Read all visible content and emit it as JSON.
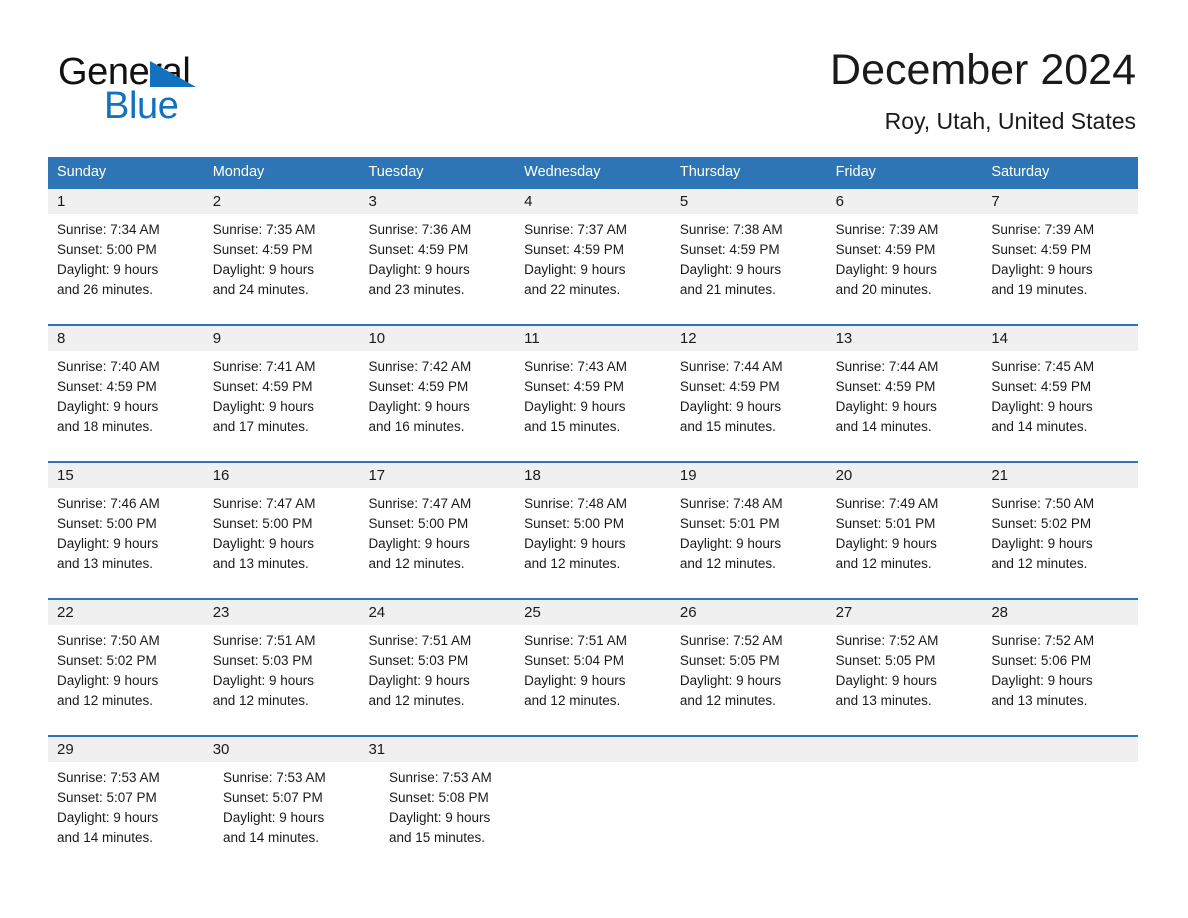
{
  "brand": {
    "name_part1": "General",
    "name_part2": "Blue",
    "triangle_icon": "blue-triangle-icon",
    "accent_color": "#1272bd"
  },
  "header": {
    "title": "December 2024",
    "location": "Roy, Utah, United States"
  },
  "theme": {
    "header_blue": "#2e75b6",
    "daynum_band": "#f0f0f0",
    "text": "#1a1a1a",
    "page_background": "#ffffff"
  },
  "weekdays": [
    "Sunday",
    "Monday",
    "Tuesday",
    "Wednesday",
    "Thursday",
    "Friday",
    "Saturday"
  ],
  "weeks": [
    {
      "days": [
        {
          "day": "1",
          "sunrise": "Sunrise: 7:34 AM",
          "sunset": "Sunset: 5:00 PM",
          "daylight_line1": "Daylight: 9 hours",
          "daylight_line2": "and 26 minutes."
        },
        {
          "day": "2",
          "sunrise": "Sunrise: 7:35 AM",
          "sunset": "Sunset: 4:59 PM",
          "daylight_line1": "Daylight: 9 hours",
          "daylight_line2": "and 24 minutes."
        },
        {
          "day": "3",
          "sunrise": "Sunrise: 7:36 AM",
          "sunset": "Sunset: 4:59 PM",
          "daylight_line1": "Daylight: 9 hours",
          "daylight_line2": "and 23 minutes."
        },
        {
          "day": "4",
          "sunrise": "Sunrise: 7:37 AM",
          "sunset": "Sunset: 4:59 PM",
          "daylight_line1": "Daylight: 9 hours",
          "daylight_line2": "and 22 minutes."
        },
        {
          "day": "5",
          "sunrise": "Sunrise: 7:38 AM",
          "sunset": "Sunset: 4:59 PM",
          "daylight_line1": "Daylight: 9 hours",
          "daylight_line2": "and 21 minutes."
        },
        {
          "day": "6",
          "sunrise": "Sunrise: 7:39 AM",
          "sunset": "Sunset: 4:59 PM",
          "daylight_line1": "Daylight: 9 hours",
          "daylight_line2": "and 20 minutes."
        },
        {
          "day": "7",
          "sunrise": "Sunrise: 7:39 AM",
          "sunset": "Sunset: 4:59 PM",
          "daylight_line1": "Daylight: 9 hours",
          "daylight_line2": "and 19 minutes."
        }
      ]
    },
    {
      "days": [
        {
          "day": "8",
          "sunrise": "Sunrise: 7:40 AM",
          "sunset": "Sunset: 4:59 PM",
          "daylight_line1": "Daylight: 9 hours",
          "daylight_line2": "and 18 minutes."
        },
        {
          "day": "9",
          "sunrise": "Sunrise: 7:41 AM",
          "sunset": "Sunset: 4:59 PM",
          "daylight_line1": "Daylight: 9 hours",
          "daylight_line2": "and 17 minutes."
        },
        {
          "day": "10",
          "sunrise": "Sunrise: 7:42 AM",
          "sunset": "Sunset: 4:59 PM",
          "daylight_line1": "Daylight: 9 hours",
          "daylight_line2": "and 16 minutes."
        },
        {
          "day": "11",
          "sunrise": "Sunrise: 7:43 AM",
          "sunset": "Sunset: 4:59 PM",
          "daylight_line1": "Daylight: 9 hours",
          "daylight_line2": "and 15 minutes."
        },
        {
          "day": "12",
          "sunrise": "Sunrise: 7:44 AM",
          "sunset": "Sunset: 4:59 PM",
          "daylight_line1": "Daylight: 9 hours",
          "daylight_line2": "and 15 minutes."
        },
        {
          "day": "13",
          "sunrise": "Sunrise: 7:44 AM",
          "sunset": "Sunset: 4:59 PM",
          "daylight_line1": "Daylight: 9 hours",
          "daylight_line2": "and 14 minutes."
        },
        {
          "day": "14",
          "sunrise": "Sunrise: 7:45 AM",
          "sunset": "Sunset: 4:59 PM",
          "daylight_line1": "Daylight: 9 hours",
          "daylight_line2": "and 14 minutes."
        }
      ]
    },
    {
      "days": [
        {
          "day": "15",
          "sunrise": "Sunrise: 7:46 AM",
          "sunset": "Sunset: 5:00 PM",
          "daylight_line1": "Daylight: 9 hours",
          "daylight_line2": "and 13 minutes."
        },
        {
          "day": "16",
          "sunrise": "Sunrise: 7:47 AM",
          "sunset": "Sunset: 5:00 PM",
          "daylight_line1": "Daylight: 9 hours",
          "daylight_line2": "and 13 minutes."
        },
        {
          "day": "17",
          "sunrise": "Sunrise: 7:47 AM",
          "sunset": "Sunset: 5:00 PM",
          "daylight_line1": "Daylight: 9 hours",
          "daylight_line2": "and 12 minutes."
        },
        {
          "day": "18",
          "sunrise": "Sunrise: 7:48 AM",
          "sunset": "Sunset: 5:00 PM",
          "daylight_line1": "Daylight: 9 hours",
          "daylight_line2": "and 12 minutes."
        },
        {
          "day": "19",
          "sunrise": "Sunrise: 7:48 AM",
          "sunset": "Sunset: 5:01 PM",
          "daylight_line1": "Daylight: 9 hours",
          "daylight_line2": "and 12 minutes."
        },
        {
          "day": "20",
          "sunrise": "Sunrise: 7:49 AM",
          "sunset": "Sunset: 5:01 PM",
          "daylight_line1": "Daylight: 9 hours",
          "daylight_line2": "and 12 minutes."
        },
        {
          "day": "21",
          "sunrise": "Sunrise: 7:50 AM",
          "sunset": "Sunset: 5:02 PM",
          "daylight_line1": "Daylight: 9 hours",
          "daylight_line2": "and 12 minutes."
        }
      ]
    },
    {
      "days": [
        {
          "day": "22",
          "sunrise": "Sunrise: 7:50 AM",
          "sunset": "Sunset: 5:02 PM",
          "daylight_line1": "Daylight: 9 hours",
          "daylight_line2": "and 12 minutes."
        },
        {
          "day": "23",
          "sunrise": "Sunrise: 7:51 AM",
          "sunset": "Sunset: 5:03 PM",
          "daylight_line1": "Daylight: 9 hours",
          "daylight_line2": "and 12 minutes."
        },
        {
          "day": "24",
          "sunrise": "Sunrise: 7:51 AM",
          "sunset": "Sunset: 5:03 PM",
          "daylight_line1": "Daylight: 9 hours",
          "daylight_line2": "and 12 minutes."
        },
        {
          "day": "25",
          "sunrise": "Sunrise: 7:51 AM",
          "sunset": "Sunset: 5:04 PM",
          "daylight_line1": "Daylight: 9 hours",
          "daylight_line2": "and 12 minutes."
        },
        {
          "day": "26",
          "sunrise": "Sunrise: 7:52 AM",
          "sunset": "Sunset: 5:05 PM",
          "daylight_line1": "Daylight: 9 hours",
          "daylight_line2": "and 12 minutes."
        },
        {
          "day": "27",
          "sunrise": "Sunrise: 7:52 AM",
          "sunset": "Sunset: 5:05 PM",
          "daylight_line1": "Daylight: 9 hours",
          "daylight_line2": "and 13 minutes."
        },
        {
          "day": "28",
          "sunrise": "Sunrise: 7:52 AM",
          "sunset": "Sunset: 5:06 PM",
          "daylight_line1": "Daylight: 9 hours",
          "daylight_line2": "and 13 minutes."
        }
      ]
    },
    {
      "days": [
        {
          "day": "29",
          "sunrise": "Sunrise: 7:53 AM",
          "sunset": "Sunset: 5:07 PM",
          "daylight_line1": "Daylight: 9 hours",
          "daylight_line2": "and 14 minutes."
        },
        {
          "day": "30",
          "sunrise": "Sunrise: 7:53 AM",
          "sunset": "Sunset: 5:07 PM",
          "daylight_line1": "Daylight: 9 hours",
          "daylight_line2": "and 14 minutes."
        },
        {
          "day": "31",
          "sunrise": "Sunrise: 7:53 AM",
          "sunset": "Sunset: 5:08 PM",
          "daylight_line1": "Daylight: 9 hours",
          "daylight_line2": "and 15 minutes."
        }
      ]
    }
  ]
}
